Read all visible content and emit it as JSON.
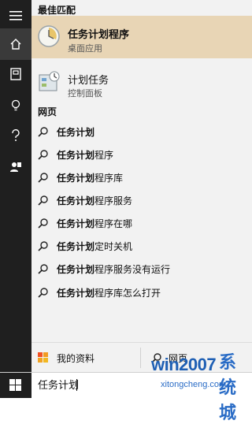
{
  "sidebar": {
    "items": [
      {
        "icon": "hamburger-menu-icon"
      },
      {
        "icon": "home-icon",
        "active": true
      },
      {
        "icon": "notebook-icon"
      },
      {
        "icon": "lightbulb-icon"
      },
      {
        "icon": "question-icon"
      },
      {
        "icon": "feedback-icon"
      }
    ]
  },
  "best_match": {
    "header": "最佳匹配",
    "title": "任务计划程序",
    "subtitle": "桌面应用",
    "icon": "task-scheduler-icon",
    "highlight_color": "#e8d5b5"
  },
  "second_result": {
    "title": "计划任务",
    "subtitle": "控制面板",
    "icon": "control-panel-schedule-icon"
  },
  "web": {
    "header": "网页",
    "items": [
      {
        "bold": "任务计划",
        "rest": ""
      },
      {
        "bold": "任务计划",
        "rest": "程序"
      },
      {
        "bold": "任务计划",
        "rest": "程序库"
      },
      {
        "bold": "任务计划",
        "rest": "程序服务"
      },
      {
        "bold": "任务计划",
        "rest": "程序在哪"
      },
      {
        "bold": "任务计划",
        "rest": "定时关机"
      },
      {
        "bold": "任务计划",
        "rest": "程序服务没有运行"
      },
      {
        "bold": "任务计划",
        "rest": "程序库怎么打开"
      }
    ]
  },
  "bottom": {
    "my_stuff_label": "我的资料",
    "web_label": "网页"
  },
  "search": {
    "value": "任务计划"
  },
  "watermark": {
    "brand": "win2007",
    "cn": "系统城",
    "url": "xitongcheng.com"
  }
}
